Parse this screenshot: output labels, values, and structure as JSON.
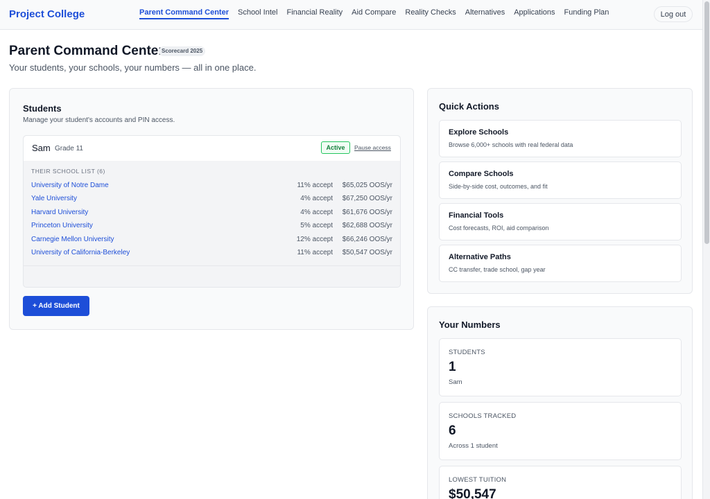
{
  "app": {
    "brand": "Project College"
  },
  "nav": {
    "items": [
      {
        "label": "Parent Command Center",
        "active": true
      },
      {
        "label": "School Intel"
      },
      {
        "label": "Financial Reality"
      },
      {
        "label": "Aid Compare"
      },
      {
        "label": "Reality Checks"
      },
      {
        "label": "Alternatives"
      },
      {
        "label": "Applications"
      },
      {
        "label": "Funding Plan"
      }
    ],
    "logout_label": "Log out"
  },
  "page": {
    "title": "Parent Command Center",
    "badge": "Scorecard 2025",
    "subtitle": "Your students, your schools, your numbers — all in one place."
  },
  "students": {
    "title": "Students",
    "subtitle": "Manage your student's accounts and PIN access.",
    "student": {
      "name": "Sam",
      "grade": "Grade 11",
      "status": "Active",
      "pause_label": "Pause access",
      "list_label": "THEIR SCHOOL LIST (6)",
      "schools": [
        {
          "name": "University of Notre Dame",
          "accept": "11% accept",
          "cost": "$65,025 OOS/yr"
        },
        {
          "name": "Yale University",
          "accept": "4% accept",
          "cost": "$67,250 OOS/yr"
        },
        {
          "name": "Harvard University",
          "accept": "4% accept",
          "cost": "$61,676 OOS/yr"
        },
        {
          "name": "Princeton University",
          "accept": "5% accept",
          "cost": "$62,688 OOS/yr"
        },
        {
          "name": "Carnegie Mellon University",
          "accept": "12% accept",
          "cost": "$66,246 OOS/yr"
        },
        {
          "name": "University of California-Berkeley",
          "accept": "11% accept",
          "cost": "$50,547 OOS/yr"
        }
      ]
    },
    "add_label": "+ Add Student"
  },
  "quick_actions": {
    "title": "Quick Actions",
    "items": [
      {
        "title": "Explore Schools",
        "desc": "Browse 6,000+ schools with real federal data"
      },
      {
        "title": "Compare Schools",
        "desc": "Side-by-side cost, outcomes, and fit"
      },
      {
        "title": "Financial Tools",
        "desc": "Cost forecasts, ROI, aid comparison"
      },
      {
        "title": "Alternative Paths",
        "desc": "CC transfer, trade school, gap year"
      }
    ]
  },
  "numbers": {
    "title": "Your Numbers",
    "items": [
      {
        "label": "STUDENTS",
        "value": "1",
        "note": "Sam"
      },
      {
        "label": "SCHOOLS TRACKED",
        "value": "6",
        "note": "Across 1 student"
      },
      {
        "label": "LOWEST TUITION",
        "value": "$50,547",
        "note": ""
      }
    ]
  }
}
